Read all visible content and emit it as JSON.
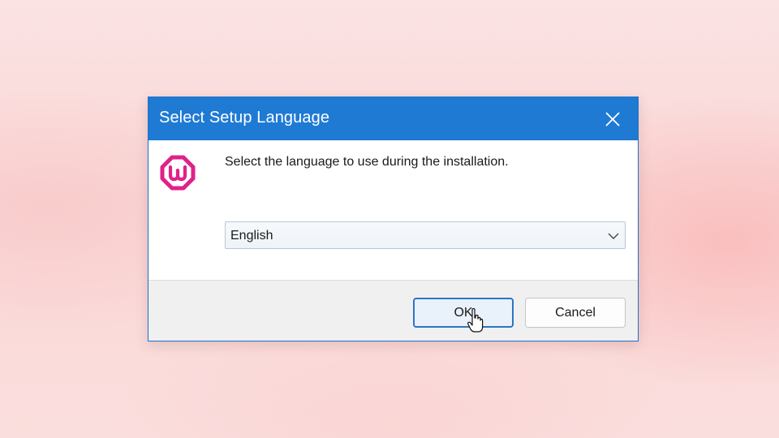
{
  "dialog": {
    "title": "Select Setup Language",
    "close_icon": "close-icon",
    "logo_icon": "wampserver-logo-icon",
    "prompt": "Select the language to use during the installation.",
    "language_select": {
      "selected": "English"
    },
    "buttons": {
      "ok": "OK",
      "cancel": "Cancel"
    }
  },
  "colors": {
    "titlebar": "#1f7ad4",
    "logo": "#e0218a",
    "ok_border": "#2e74c4"
  },
  "cursor_icon": "hand-pointer-icon"
}
